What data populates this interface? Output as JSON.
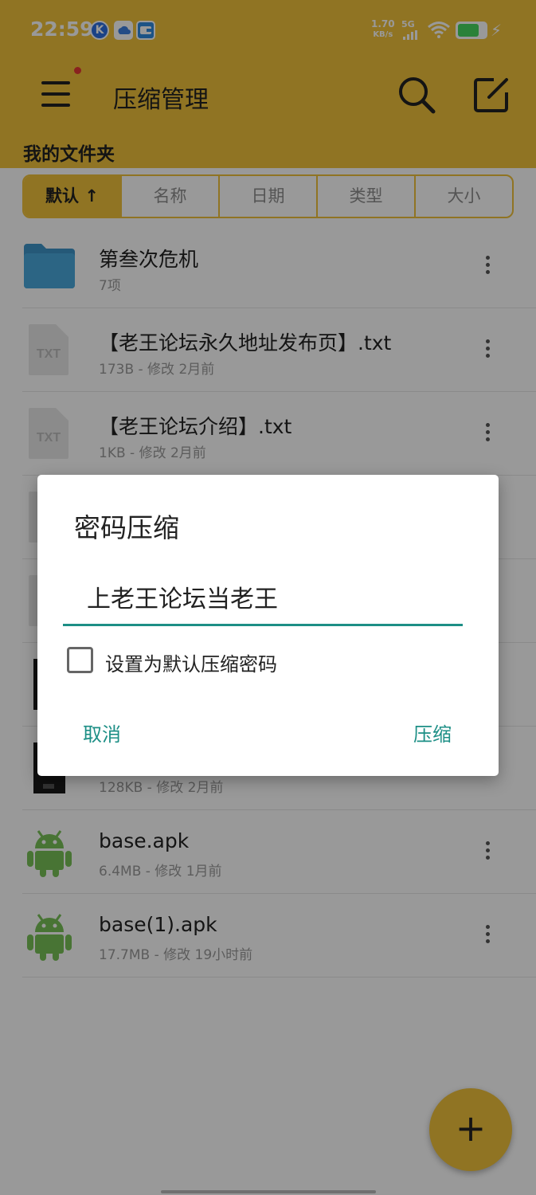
{
  "status_bar": {
    "time": "22:59",
    "net_speed_value": "1.70",
    "net_speed_unit": "KB/s",
    "network_type": "5G",
    "battery_level": 0.75,
    "app_icons": [
      "k-app-icon",
      "cloud-app-icon",
      "wallet-app-icon"
    ]
  },
  "app_bar": {
    "title": "压缩管理",
    "folder_title": "我的文件夹"
  },
  "sort_tabs": [
    {
      "label": "默认 ↑",
      "active": true
    },
    {
      "label": "名称",
      "active": false
    },
    {
      "label": "日期",
      "active": false
    },
    {
      "label": "类型",
      "active": false
    },
    {
      "label": "大小",
      "active": false
    }
  ],
  "files": [
    {
      "name": "第叁次危机",
      "meta": "7项",
      "icon": "folder-icon"
    },
    {
      "name": "【老王论坛永久地址发布页】.txt",
      "meta": "173B - 修改 2月前",
      "icon": "txt-file-icon"
    },
    {
      "name": "【老王论坛介绍】.txt",
      "meta": "1KB - 修改 2月前",
      "icon": "txt-file-icon"
    },
    {
      "name": "",
      "meta": "",
      "icon": "txt-file-icon"
    },
    {
      "name": "",
      "meta": "",
      "icon": "txt-file-icon"
    },
    {
      "name": "",
      "meta": "",
      "icon": "image-thumbnail-icon"
    },
    {
      "name": "",
      "meta": "128KB - 修改 2月前",
      "icon": "image-thumbnail-icon"
    },
    {
      "name": "base.apk",
      "meta": "6.4MB - 修改 1月前",
      "icon": "android-icon"
    },
    {
      "name": "base(1).apk",
      "meta": "17.7MB - 修改 19小时前",
      "icon": "android-icon"
    }
  ],
  "fab": {
    "label": "+"
  },
  "dialog": {
    "title": "密码压缩",
    "password_value": "上老王论坛当老王",
    "checkbox_label": "设置为默认压缩密码",
    "checkbox_checked": false,
    "cancel_label": "取消",
    "confirm_label": "压缩"
  },
  "colors": {
    "accent": "#f0c23b",
    "dialog_button": "#1d8f86",
    "folder": "#4aa8dc",
    "android": "#78c257"
  }
}
